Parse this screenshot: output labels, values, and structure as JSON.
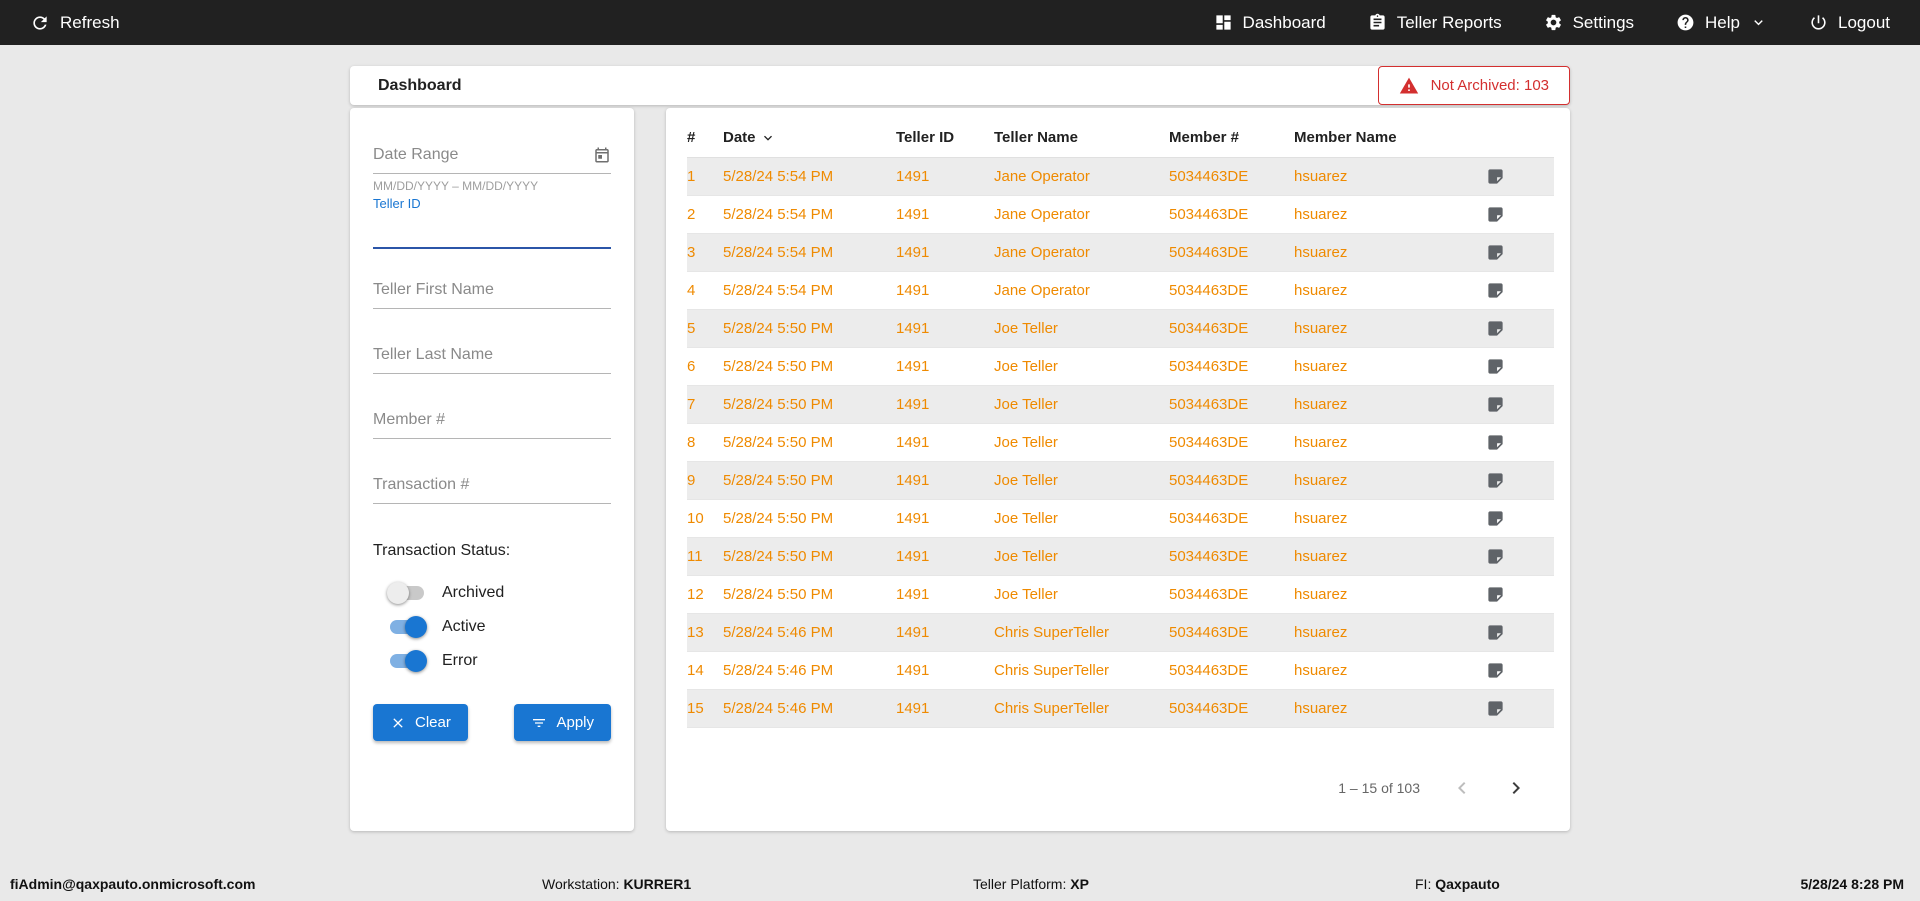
{
  "colors": {
    "accent": "#1976d2",
    "row_text": "#ef8a00",
    "alert": "#d32f2f",
    "topbar_bg": "#212121"
  },
  "topbar": {
    "refresh_label": "Refresh",
    "nav": [
      {
        "icon": "dashboard-icon",
        "label": "Dashboard"
      },
      {
        "icon": "teller-reports-icon",
        "label": "Teller Reports"
      },
      {
        "icon": "settings-gear-icon",
        "label": "Settings"
      },
      {
        "icon": "help-icon",
        "label": "Help",
        "has_dropdown": true
      },
      {
        "icon": "logout-power-icon",
        "label": "Logout"
      }
    ]
  },
  "header": {
    "title": "Dashboard",
    "not_archived_label": "Not Archived: 103"
  },
  "filters": {
    "date_range_placeholder": "Date Range",
    "date_hint": "MM/DD/YYYY – MM/DD/YYYY",
    "teller_id_label": "Teller ID",
    "teller_first_placeholder": "Teller First Name",
    "teller_last_placeholder": "Teller Last Name",
    "member_placeholder": "Member #",
    "transaction_placeholder": "Transaction #",
    "status_label": "Transaction Status:",
    "toggles": [
      {
        "label": "Archived",
        "on": false
      },
      {
        "label": "Active",
        "on": true
      },
      {
        "label": "Error",
        "on": true
      }
    ],
    "clear_label": "Clear",
    "apply_label": "Apply"
  },
  "table": {
    "columns": [
      "#",
      "Date",
      "Teller ID",
      "Teller Name",
      "Member #",
      "Member Name"
    ],
    "sort_column": "Date",
    "rows": [
      {
        "num": "1",
        "date": "5/28/24 5:54 PM",
        "teller_id": "1491",
        "teller_name": "Jane Operator",
        "member": "5034463DE",
        "member_name": "hsuarez"
      },
      {
        "num": "2",
        "date": "5/28/24 5:54 PM",
        "teller_id": "1491",
        "teller_name": "Jane Operator",
        "member": "5034463DE",
        "member_name": "hsuarez"
      },
      {
        "num": "3",
        "date": "5/28/24 5:54 PM",
        "teller_id": "1491",
        "teller_name": "Jane Operator",
        "member": "5034463DE",
        "member_name": "hsuarez"
      },
      {
        "num": "4",
        "date": "5/28/24 5:54 PM",
        "teller_id": "1491",
        "teller_name": "Jane Operator",
        "member": "5034463DE",
        "member_name": "hsuarez"
      },
      {
        "num": "5",
        "date": "5/28/24 5:50 PM",
        "teller_id": "1491",
        "teller_name": "Joe Teller",
        "member": "5034463DE",
        "member_name": "hsuarez"
      },
      {
        "num": "6",
        "date": "5/28/24 5:50 PM",
        "teller_id": "1491",
        "teller_name": "Joe Teller",
        "member": "5034463DE",
        "member_name": "hsuarez"
      },
      {
        "num": "7",
        "date": "5/28/24 5:50 PM",
        "teller_id": "1491",
        "teller_name": "Joe Teller",
        "member": "5034463DE",
        "member_name": "hsuarez"
      },
      {
        "num": "8",
        "date": "5/28/24 5:50 PM",
        "teller_id": "1491",
        "teller_name": "Joe Teller",
        "member": "5034463DE",
        "member_name": "hsuarez"
      },
      {
        "num": "9",
        "date": "5/28/24 5:50 PM",
        "teller_id": "1491",
        "teller_name": "Joe Teller",
        "member": "5034463DE",
        "member_name": "hsuarez"
      },
      {
        "num": "10",
        "date": "5/28/24 5:50 PM",
        "teller_id": "1491",
        "teller_name": "Joe Teller",
        "member": "5034463DE",
        "member_name": "hsuarez"
      },
      {
        "num": "11",
        "date": "5/28/24 5:50 PM",
        "teller_id": "1491",
        "teller_name": "Joe Teller",
        "member": "5034463DE",
        "member_name": "hsuarez"
      },
      {
        "num": "12",
        "date": "5/28/24 5:50 PM",
        "teller_id": "1491",
        "teller_name": "Joe Teller",
        "member": "5034463DE",
        "member_name": "hsuarez"
      },
      {
        "num": "13",
        "date": "5/28/24 5:46 PM",
        "teller_id": "1491",
        "teller_name": "Chris SuperTeller",
        "member": "5034463DE",
        "member_name": "hsuarez"
      },
      {
        "num": "14",
        "date": "5/28/24 5:46 PM",
        "teller_id": "1491",
        "teller_name": "Chris SuperTeller",
        "member": "5034463DE",
        "member_name": "hsuarez"
      },
      {
        "num": "15",
        "date": "5/28/24 5:46 PM",
        "teller_id": "1491",
        "teller_name": "Chris SuperTeller",
        "member": "5034463DE",
        "member_name": "hsuarez"
      }
    ],
    "pagination": {
      "range_label": "1 – 15 of 103"
    }
  },
  "footer": {
    "user": "fiAdmin@qaxpauto.onmicrosoft.com",
    "workstation_label": "Workstation:",
    "workstation_value": "KURRER1",
    "platform_label": "Teller Platform:",
    "platform_value": "XP",
    "fi_label": "FI:",
    "fi_value": "Qaxpauto",
    "datetime": "5/28/24 8:28 PM"
  }
}
